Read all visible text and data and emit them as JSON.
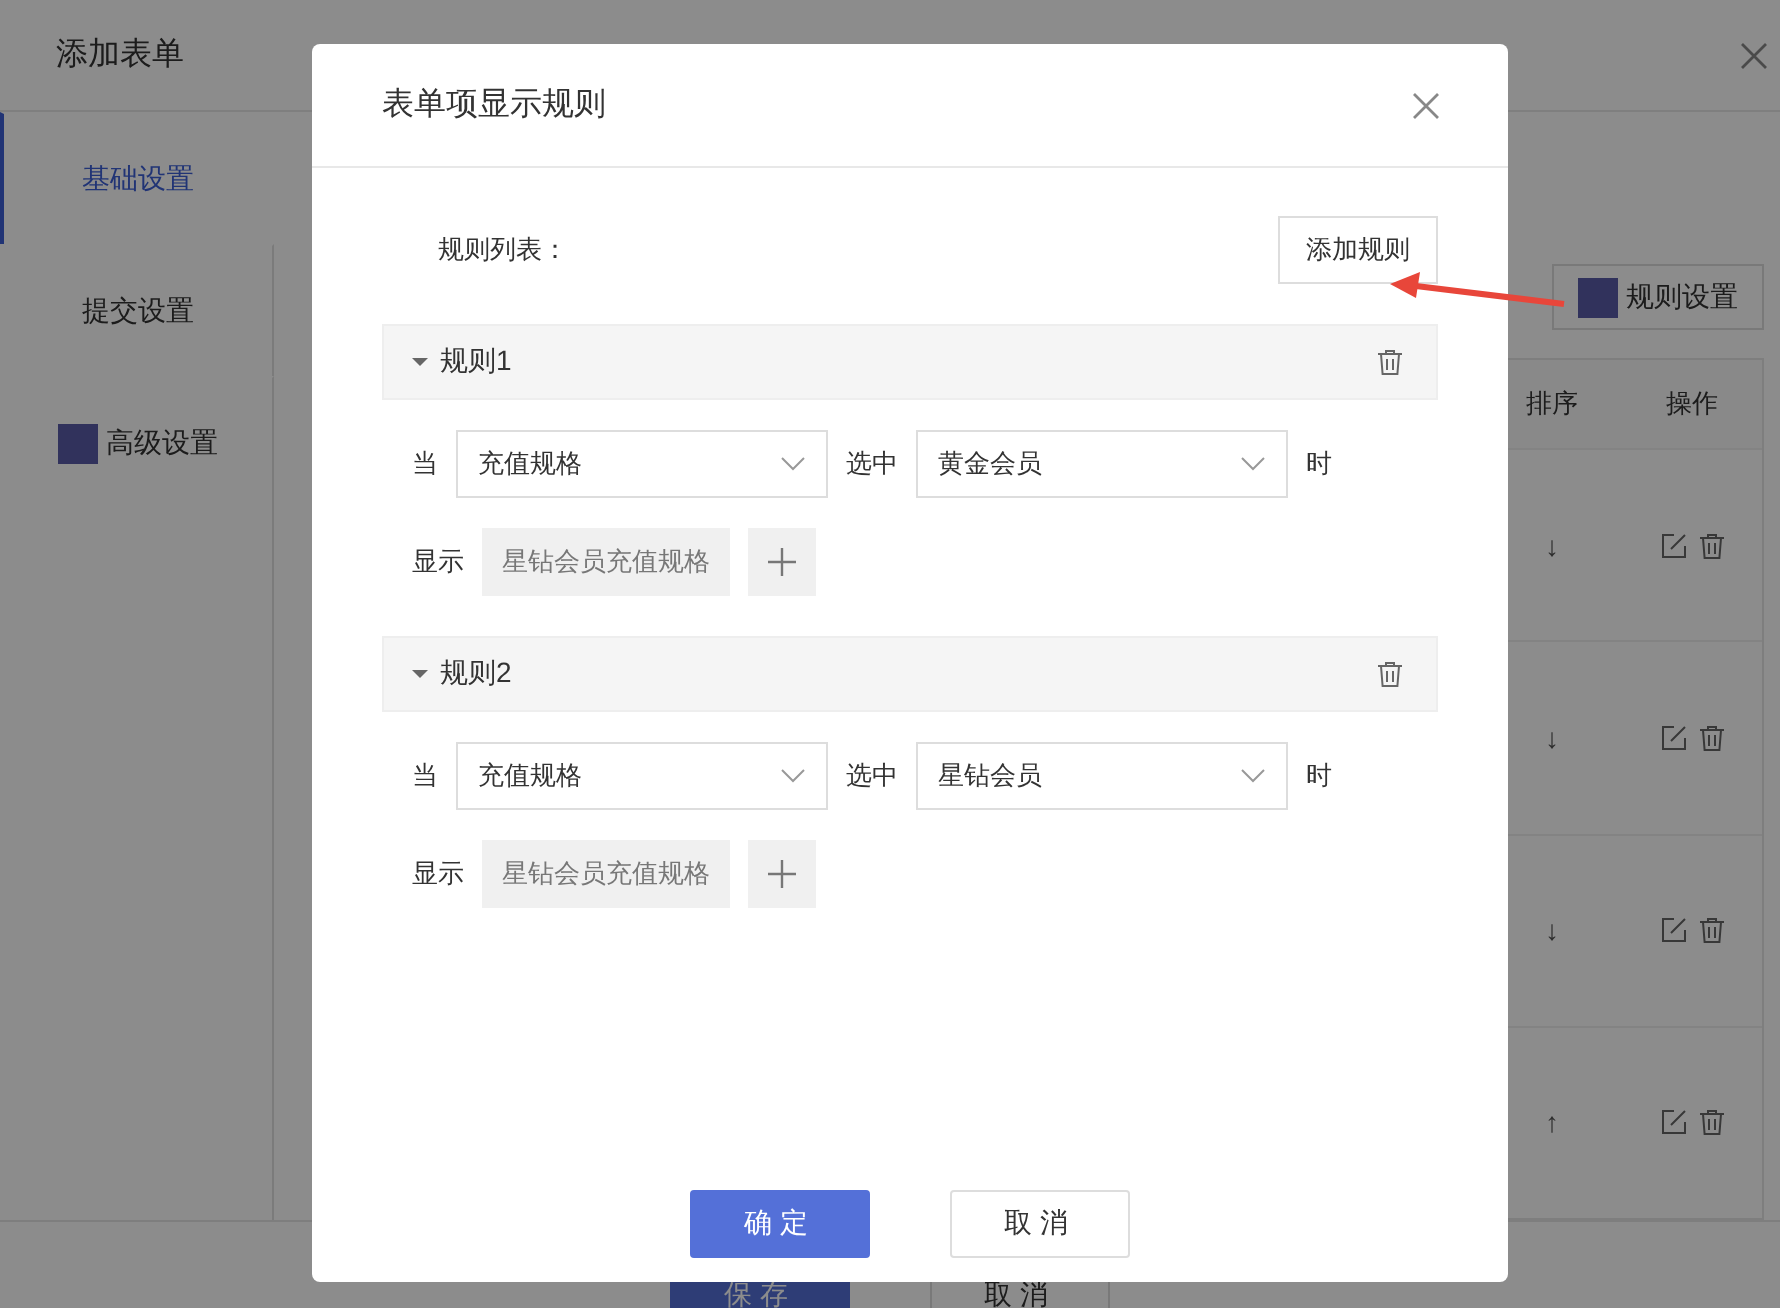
{
  "page": {
    "title": "添加表单",
    "tabs": [
      {
        "label": "基础设置",
        "selected": true,
        "has_icon": false
      },
      {
        "label": "提交设置",
        "selected": false,
        "has_icon": false
      },
      {
        "label": "高级设置",
        "selected": false,
        "has_icon": true
      }
    ],
    "rule_settings_button": "规则设置",
    "table": {
      "columns": [
        "排序",
        "操作"
      ],
      "rows": [
        {
          "sort": "↓"
        },
        {
          "sort": "↓"
        },
        {
          "sort": "↓"
        },
        {
          "sort": "↑"
        }
      ]
    },
    "footer_buttons": [
      {
        "label": "保存",
        "kind": "primary"
      },
      {
        "label": "取消",
        "kind": "default"
      }
    ]
  },
  "dialog": {
    "title": "表单项显示规则",
    "list_label": "规则列表：",
    "add_button": "添加规则",
    "rules": [
      {
        "title": "规则1",
        "expanded": true,
        "when_label": "当",
        "field": "充值规格",
        "selected_label": "选中",
        "value": "黄金会员",
        "then_label": "时",
        "show_label": "显示",
        "shown_items": [
          "星钻会员充值规格"
        ]
      },
      {
        "title": "规则2",
        "expanded": true,
        "when_label": "当",
        "field": "充值规格",
        "selected_label": "选中",
        "value": "星钻会员",
        "then_label": "时",
        "show_label": "显示",
        "shown_items": [
          "星钻会员充值规格"
        ]
      }
    ],
    "buttons": [
      {
        "label": "确定",
        "kind": "primary"
      },
      {
        "label": "取消",
        "kind": "default"
      }
    ]
  }
}
